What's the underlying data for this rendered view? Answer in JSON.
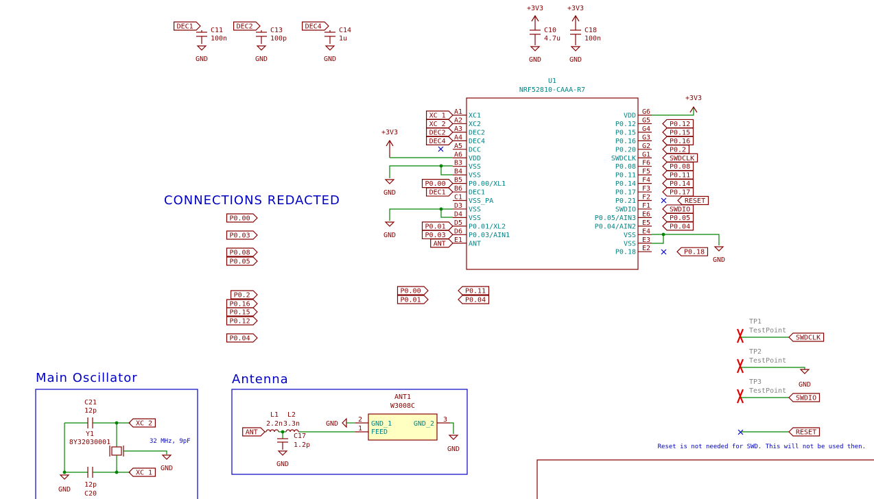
{
  "text_block": {
    "connections_redacted": "CONNECTIONS REDACTED",
    "main_oscillator": "Main Oscillator",
    "antenna": "Antenna",
    "reset_note": "Reset is not needed for SWD. This will not be used then."
  },
  "decaps": [
    {
      "net": "DEC1",
      "ref": "C11",
      "value": "100n",
      "gnd": "GND"
    },
    {
      "net": "DEC2",
      "ref": "C13",
      "value": "100p",
      "gnd": "GND"
    },
    {
      "net": "DEC4",
      "ref": "C14",
      "value": "1u",
      "gnd": "GND"
    }
  ],
  "supply_caps": [
    {
      "power": "+3V3",
      "ref": "C10",
      "value": "4.7u",
      "gnd": "GND"
    },
    {
      "power": "+3V3",
      "ref": "C18",
      "value": "100n",
      "gnd": "GND"
    }
  ],
  "u1": {
    "ref": "U1",
    "part": "NRF52810-CAAA-R7",
    "left_pins": [
      {
        "num": "A1",
        "name": "XC1",
        "net": "XC_1"
      },
      {
        "num": "A2",
        "name": "XC2",
        "net": "XC_2"
      },
      {
        "num": "A3",
        "name": "DEC2",
        "net": "DEC2"
      },
      {
        "num": "A4",
        "name": "DEC4",
        "net": "DEC4"
      },
      {
        "num": "A5",
        "name": "DCC",
        "net": ""
      },
      {
        "num": "A6",
        "name": "VDD",
        "net": ""
      },
      {
        "num": "B3",
        "name": "VSS",
        "net": ""
      },
      {
        "num": "B4",
        "name": "VSS",
        "net": ""
      },
      {
        "num": "B5",
        "name": "P0.00/XL1",
        "net": "P0.00"
      },
      {
        "num": "B6",
        "name": "DEC1",
        "net": "DEC1"
      },
      {
        "num": "C1",
        "name": "VSS_PA",
        "net": ""
      },
      {
        "num": "D3",
        "name": "VSS",
        "net": ""
      },
      {
        "num": "D4",
        "name": "VSS",
        "net": ""
      },
      {
        "num": "D5",
        "name": "P0.01/XL2",
        "net": "P0.01"
      },
      {
        "num": "D6",
        "name": "P0.03/AIN1",
        "net": "P0.03"
      },
      {
        "num": "E1",
        "name": "ANT",
        "net": "ANT"
      }
    ],
    "right_pins": [
      {
        "num": "G6",
        "name": "VDD",
        "net": ""
      },
      {
        "num": "G5",
        "name": "P0.12",
        "net": "P0.12"
      },
      {
        "num": "G4",
        "name": "P0.15",
        "net": "P0.15"
      },
      {
        "num": "G3",
        "name": "P0.16",
        "net": "P0.16"
      },
      {
        "num": "G2",
        "name": "P0.20",
        "net": "P0.2"
      },
      {
        "num": "G1",
        "name": "SWDCLK",
        "net": "SWDCLK"
      },
      {
        "num": "F6",
        "name": "P0.08",
        "net": "P0.08"
      },
      {
        "num": "F5",
        "name": "P0.11",
        "net": "P0.11"
      },
      {
        "num": "F4",
        "name": "P0.14",
        "net": "P0.14"
      },
      {
        "num": "F3",
        "name": "P0.17",
        "net": "P0.17"
      },
      {
        "num": "F2",
        "name": "P0.21",
        "net": "RESET"
      },
      {
        "num": "F1",
        "name": "SWDIO",
        "net": "SWDIO"
      },
      {
        "num": "E6",
        "name": "P0.05/AIN3",
        "net": "P0.05"
      },
      {
        "num": "E5",
        "name": "P0.04/AIN2",
        "net": "P0.04"
      },
      {
        "num": "E4",
        "name": "VSS",
        "net": ""
      },
      {
        "num": "E3",
        "name": "VSS",
        "net": ""
      },
      {
        "num": "E2",
        "name": "P0.18",
        "net": "P0.18"
      }
    ],
    "power_left": "+3V3",
    "power_right": "+3V3",
    "gnd": "GND"
  },
  "redacted_labels": {
    "a": [
      "P0.00",
      "P0.03",
      "P0.08",
      "P0.05"
    ],
    "b": [
      "P0.2",
      "P0.16",
      "P0.15",
      "P0.12",
      "P0.04"
    ],
    "c": [
      "P0.00",
      "P0.01"
    ],
    "d": [
      "P0.11",
      "P0.04"
    ]
  },
  "oscillator": {
    "c21_ref": "C21",
    "c21_val": "12p",
    "y1_ref": "Y1",
    "y1_part": "8Y32030001",
    "y1_note": "32 MHz, 9pF",
    "c20_ref": "C20",
    "c20_val": "12p",
    "net1": "XC_2",
    "net2": "XC_1",
    "gnd": "GND"
  },
  "antenna": {
    "l1_ref": "L1",
    "l1_val": "2.2n",
    "l2_ref": "L2",
    "l2_val": "3.3n",
    "c17_ref": "C17",
    "c17_val": "1.2p",
    "ant_ref": "ANT1",
    "ant_part": "W3008C",
    "pin_gnd1": "GND_1",
    "pin_feed": "FEED",
    "pin_gnd2": "GND_2",
    "num2": "2",
    "num1": "1",
    "num3": "3",
    "net": "ANT",
    "gnd": "GND"
  },
  "testpoints": [
    {
      "ref": "TP1",
      "label": "TestPoint",
      "net": "SWDCLK"
    },
    {
      "ref": "TP2",
      "label": "TestPoint",
      "net": "GND"
    },
    {
      "ref": "TP3",
      "label": "TestPoint",
      "net": "SWDIO"
    }
  ],
  "reset_label": "RESET"
}
